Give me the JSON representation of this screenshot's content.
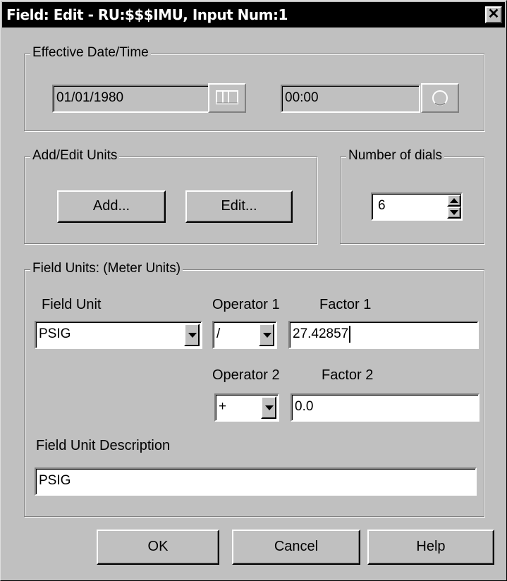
{
  "window": {
    "title": "Field: Edit -  RU:$$$IMU, Input Num:1",
    "close_glyph": "✕"
  },
  "effective": {
    "legend": "Effective Date/Time",
    "date_value": "01/01/1980",
    "time_value": "00:00",
    "calendar_icon": "calendar-icon",
    "clock_icon": "clock-icon"
  },
  "units": {
    "legend": "Add/Edit Units",
    "add_label": "Add...",
    "edit_label": "Edit..."
  },
  "dials": {
    "legend": "Number of dials",
    "value": "6"
  },
  "field_units": {
    "legend": "Field Units: (Meter Units)",
    "field_unit_label": "Field Unit",
    "field_unit_value": "PSIG",
    "operator1_label": "Operator 1",
    "operator1_value": "/",
    "factor1_label": "Factor 1",
    "factor1_value": "27.42857",
    "operator2_label": "Operator 2",
    "operator2_value": "+",
    "factor2_label": "Factor 2",
    "factor2_value": "0.0",
    "description_label": "Field Unit Description",
    "description_value": "PSIG"
  },
  "buttons": {
    "ok": "OK",
    "cancel": "Cancel",
    "help": "Help"
  }
}
